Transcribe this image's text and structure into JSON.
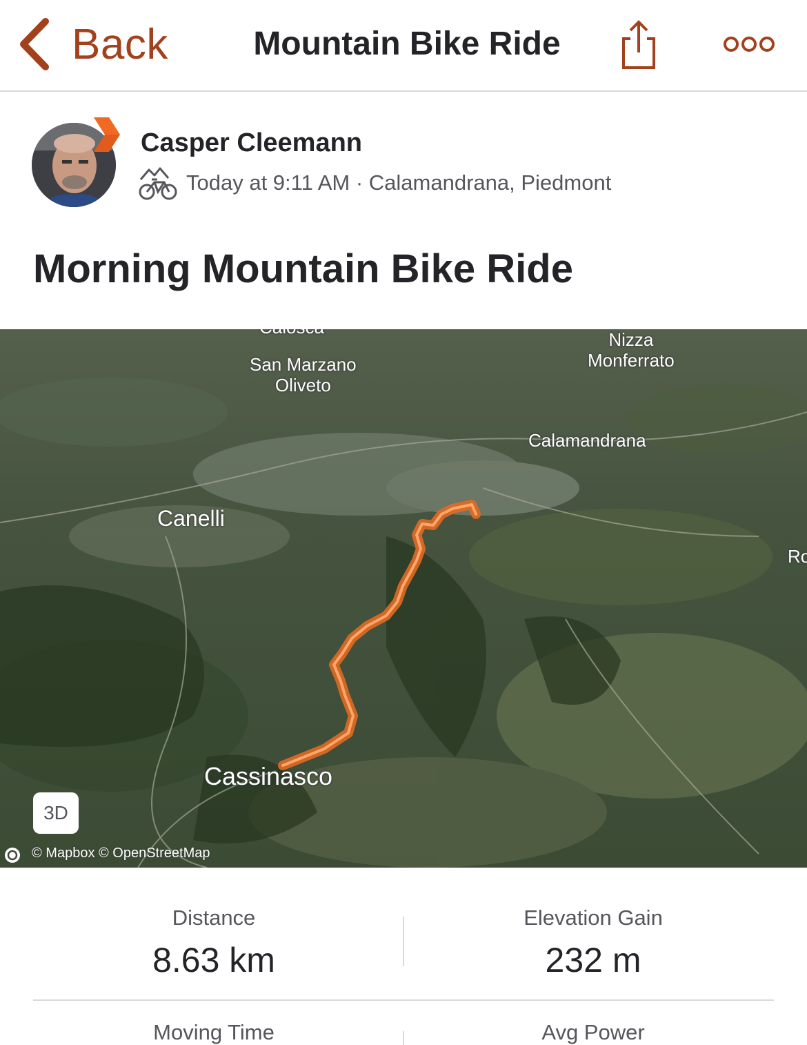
{
  "nav": {
    "back_label": "Back",
    "title": "Mountain Bike Ride",
    "icons": {
      "back": "chevron-left-icon",
      "share": "share-icon",
      "more": "more-dots-icon"
    },
    "accent_color": "#a3411c"
  },
  "athlete": {
    "name": "Casper Cleemann",
    "activity_type_icon": "mountain-bike-icon",
    "meta": "Today at 9:11 AM · Calamandrana, Piedmont",
    "badge_color": "#e05b1c"
  },
  "activity": {
    "title": "Morning Mountain Bike Ride"
  },
  "map": {
    "labels": {
      "calosso": "Calosca",
      "san_marzano": "San Marzano\nOliveto",
      "nizza": "Nizza\nMonferrato",
      "calamandrana": "Calamandrana",
      "canelli": "Canelli",
      "cassinasco": "Cassinasco",
      "edge": "Ro"
    },
    "button_3d": "3D",
    "attribution": "© Mapbox © OpenStreetMap",
    "route_color": "#f0782e"
  },
  "stats": [
    {
      "label": "Distance",
      "value": "8.63 km"
    },
    {
      "label": "Elevation Gain",
      "value": "232 m"
    },
    {
      "label": "Moving Time",
      "value": ""
    },
    {
      "label": "Avg Power",
      "value": ""
    }
  ]
}
